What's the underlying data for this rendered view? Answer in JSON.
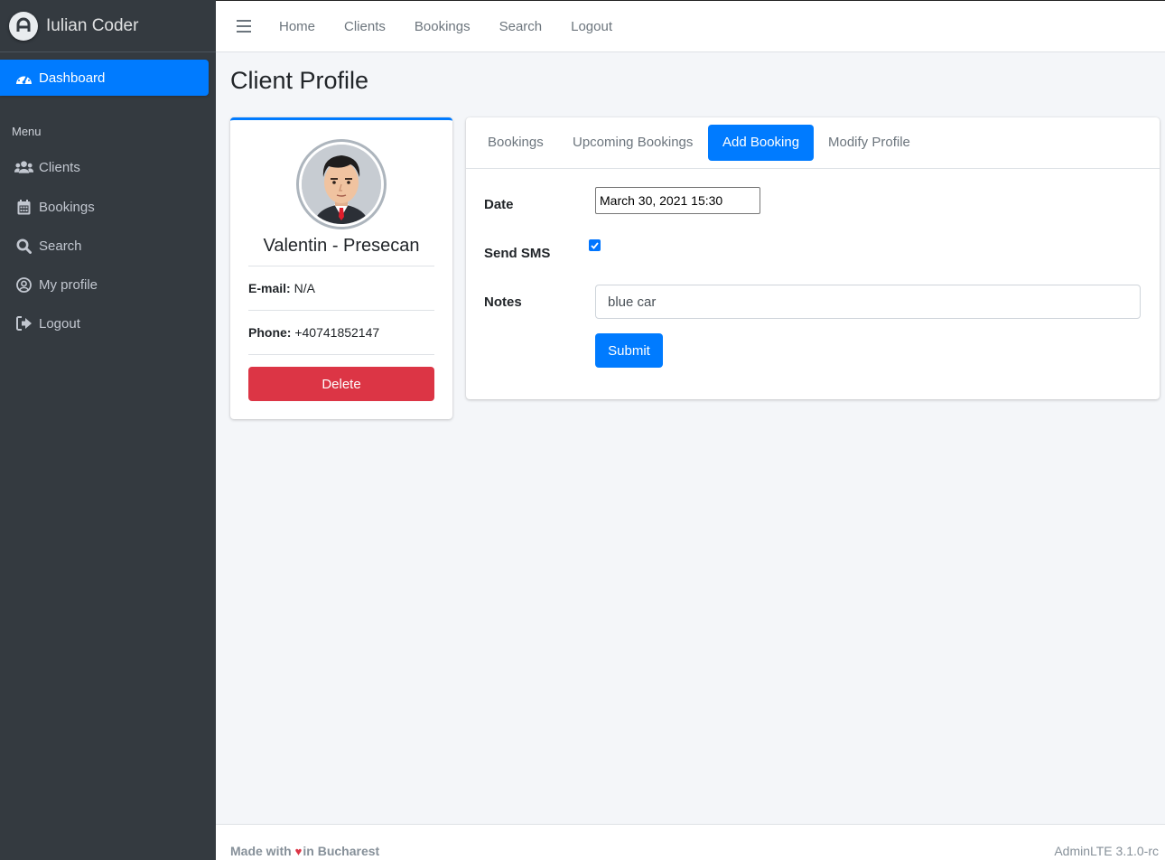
{
  "sidebar": {
    "brand": "Iulian Coder",
    "active_item": "Dashboard",
    "menu_header": "Menu",
    "items": [
      {
        "label": "Clients",
        "icon": "users-icon"
      },
      {
        "label": "Bookings",
        "icon": "calendar-icon"
      },
      {
        "label": "Search",
        "icon": "search-icon"
      },
      {
        "label": "My profile",
        "icon": "user-circle-icon"
      },
      {
        "label": "Logout",
        "icon": "sign-out-icon"
      }
    ]
  },
  "topbar": {
    "links": [
      "Home",
      "Clients",
      "Bookings",
      "Search",
      "Logout"
    ]
  },
  "page": {
    "title": "Client Profile"
  },
  "profile": {
    "name": "Valentin - Presecan",
    "email_label": "E-mail:",
    "email": "N/A",
    "phone_label": "Phone:",
    "phone": "+40741852147",
    "delete_label": "Delete"
  },
  "tabs": [
    "Bookings",
    "Upcoming Bookings",
    "Add Booking",
    "Modify Profile"
  ],
  "active_tab": "Add Booking",
  "form": {
    "date_label": "Date",
    "date_value": "March 30, 2021 15:30",
    "sms_label": "Send SMS",
    "sms_checked": true,
    "notes_label": "Notes",
    "notes_value": "blue car",
    "submit_label": "Submit"
  },
  "footer": {
    "made_with": "Made with",
    "in_city": "in Bucharest",
    "version": "AdminLTE 3.1.0-rc"
  },
  "colors": {
    "primary": "#007bff",
    "danger": "#dc3545",
    "sidebar_bg": "#343a40"
  }
}
